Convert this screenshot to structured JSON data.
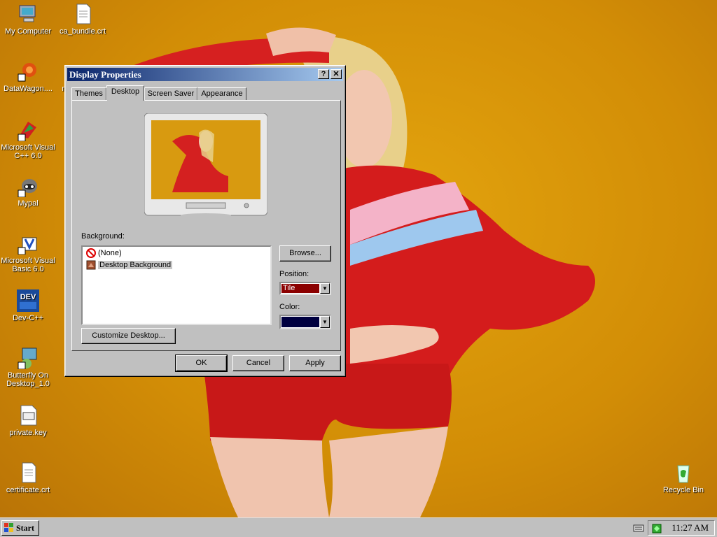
{
  "desktop": {
    "icons": [
      {
        "label": "My Computer",
        "icon": "my-computer-icon"
      },
      {
        "label": "ca_bundle.crt",
        "icon": "certificate-file-icon"
      },
      {
        "label": "DataWagon....",
        "icon": "datawagon-icon"
      },
      {
        "label": "Microsoft Visual\nC++ 6.0",
        "icon": "visual-cpp-icon"
      },
      {
        "label": "Mypal",
        "icon": "mypal-icon"
      },
      {
        "label": "Microsoft Visual\nBasic 6.0",
        "icon": "visual-basic-icon"
      },
      {
        "label": "Dev-C++",
        "icon": "devcpp-icon"
      },
      {
        "label": "Butterfly On\nDesktop_1.0",
        "icon": "butterfly-icon"
      },
      {
        "label": "private.key",
        "icon": "key-file-icon"
      },
      {
        "label": "certificate.crt",
        "icon": "certificate-file-icon"
      },
      {
        "label": "Recycle Bin",
        "icon": "recycle-bin-icon"
      },
      {
        "label": "m",
        "icon": "partial-icon"
      }
    ]
  },
  "dialog": {
    "title": "Display Properties",
    "help_btn": "?",
    "close_btn": "✕",
    "tabs": [
      {
        "label": "Themes"
      },
      {
        "label": "Desktop",
        "active": true
      },
      {
        "label": "Screen Saver"
      },
      {
        "label": "Appearance"
      }
    ],
    "background_label": "Background:",
    "background_items": [
      {
        "label": "(None)",
        "icon": "none-icon"
      },
      {
        "label": "Desktop Background",
        "icon": "picture-icon",
        "selected": true
      }
    ],
    "browse_label": "Browse...",
    "position_label": "Position:",
    "position_value": "Tile",
    "color_label": "Color:",
    "color_value": "#000040",
    "customize_label": "Customize Desktop...",
    "ok_label": "OK",
    "cancel_label": "Cancel",
    "apply_label": "Apply"
  },
  "taskbar": {
    "start_label": "Start",
    "clock": "11:27 AM"
  },
  "colors": {
    "titlebar_start": "#0a246a",
    "titlebar_end": "#a6caf0",
    "wallpaper": "#d8950a",
    "position_bg": "#8b0000"
  }
}
